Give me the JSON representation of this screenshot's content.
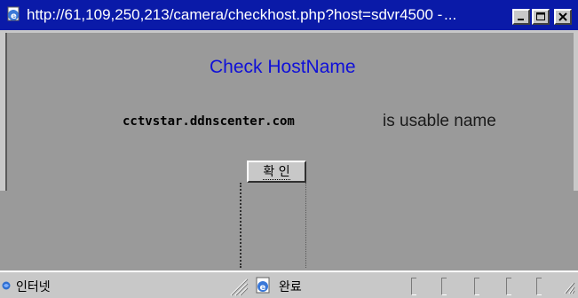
{
  "window": {
    "title": "http://61,109,250,213/camera/checkhost.php?host=sdvr4500 -",
    "title_ellipsis": "...",
    "title_bar_color": "#0a1aa8",
    "icon": "ie-page-icon",
    "controls": {
      "minimize_icon": "minimize-icon",
      "maximize_icon": "maximize-icon",
      "close_icon": "close-icon"
    }
  },
  "page": {
    "heading": "Check HostName",
    "heading_color": "#1010d8",
    "hostname": "cctvstar.ddnscenter.com",
    "result_text": "is usable name",
    "confirm_button_label": "확 인"
  },
  "statusbar": {
    "zone_label": "인터넷",
    "zone_icon": "internet-icon",
    "page_icon": "ie-page-icon",
    "done_label": "완료"
  }
}
